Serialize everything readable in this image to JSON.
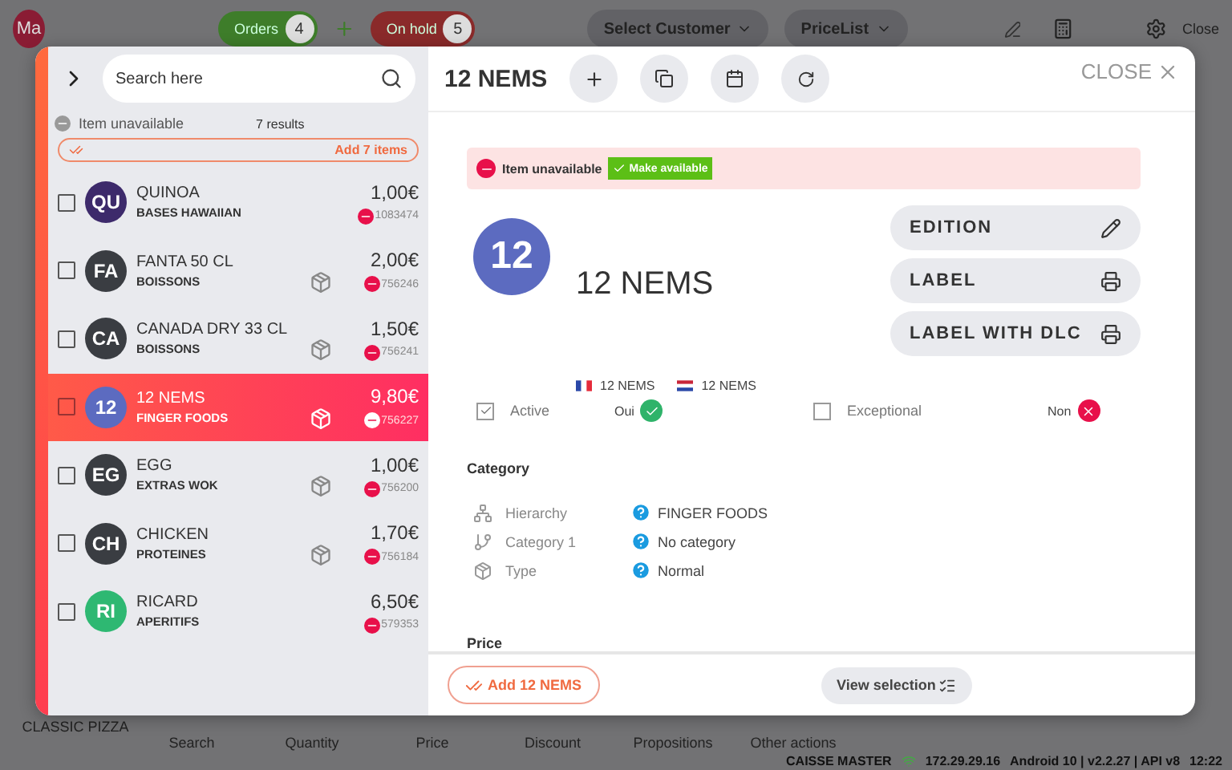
{
  "top_bar": {
    "avatar": "Ma",
    "orders": {
      "label": "Orders",
      "count": "4"
    },
    "on_hold": {
      "label": "On hold",
      "count": "5"
    },
    "customer_select": "Select Customer",
    "pricelist_select": "PriceList",
    "close_label": "Close"
  },
  "bottom_bar": {
    "product": "CLASSIC PIZZA",
    "actions": [
      "Search",
      "Quantity",
      "Price",
      "Discount",
      "Propositions",
      "Other actions"
    ]
  },
  "status_bar": {
    "device": "CAISSE MASTER",
    "ip": "172.29.29.16",
    "version": "Android 10 | v2.2.27 | API v8",
    "time": "12:22"
  },
  "list_panel": {
    "search": {
      "placeholder": "Search here"
    },
    "filter": {
      "label": "Item unavailable",
      "results": "7 results"
    },
    "add_all": "Add 7 items",
    "items": [
      {
        "initials": "QU",
        "name": "QUINOA",
        "category": "BASES HAWAIIAN",
        "price": "1,00€",
        "code": "1083474",
        "color": "#3d2a6b",
        "boxed": false,
        "checked": false,
        "selected": false
      },
      {
        "initials": "FA",
        "name": "FANTA 50 CL",
        "category": "BOISSONS",
        "price": "2,00€",
        "code": "756246",
        "color": "#3a3d42",
        "boxed": true,
        "checked": false,
        "selected": false
      },
      {
        "initials": "CA",
        "name": "CANADA DRY 33 CL",
        "category": "BOISSONS",
        "price": "1,50€",
        "code": "756241",
        "color": "#3a3d42",
        "boxed": true,
        "checked": false,
        "selected": false
      },
      {
        "initials": "12",
        "name": "12 NEMS",
        "category": "FINGER FOODS",
        "price": "9,80€",
        "code": "756227",
        "color": "#5c6bc0",
        "boxed": true,
        "checked": false,
        "selected": true
      },
      {
        "initials": "EG",
        "name": "EGG",
        "category": "EXTRAS WOK",
        "price": "1,00€",
        "code": "756200",
        "color": "#3a3d42",
        "boxed": true,
        "checked": false,
        "selected": false
      },
      {
        "initials": "CH",
        "name": "CHICKEN",
        "category": "PROTEINES",
        "price": "1,70€",
        "code": "756184",
        "color": "#3a3d42",
        "boxed": true,
        "checked": false,
        "selected": false
      },
      {
        "initials": "RI",
        "name": "RICARD",
        "category": "APERITIFS",
        "price": "6,50€",
        "code": "579353",
        "color": "#2eb872",
        "boxed": false,
        "checked": false,
        "selected": false
      }
    ]
  },
  "detail": {
    "title": "12 NEMS",
    "close": "CLOSE",
    "banner": {
      "label": "Item unavailable",
      "action": "Make available"
    },
    "avatar": "12",
    "color": "#5c6bc0",
    "name": "12 NEMS",
    "actions": [
      {
        "label": "EDITION",
        "kind": "edit"
      },
      {
        "label": "LABEL",
        "kind": "print"
      },
      {
        "label": "LABEL WITH DLC",
        "kind": "print"
      }
    ],
    "translations": [
      {
        "kind": "fr",
        "text": "12 NEMS"
      },
      {
        "kind": "nl",
        "text": "12 NEMS"
      }
    ],
    "flags": [
      {
        "label": "Active",
        "checked": true,
        "value": "Oui"
      },
      {
        "label": "Exceptional",
        "checked": false,
        "value": "Non"
      }
    ],
    "category": {
      "heading": "Category",
      "rows": [
        {
          "kind": "hierarchy",
          "label": "Hierarchy",
          "value": "FINGER FOODS"
        },
        {
          "kind": "branch",
          "label": "Category 1",
          "value": "No category"
        },
        {
          "kind": "type",
          "label": "Type",
          "value": "Normal"
        }
      ]
    },
    "price_heading": "Price",
    "footer": {
      "add": "Add 12 NEMS",
      "view": "View selection"
    }
  }
}
